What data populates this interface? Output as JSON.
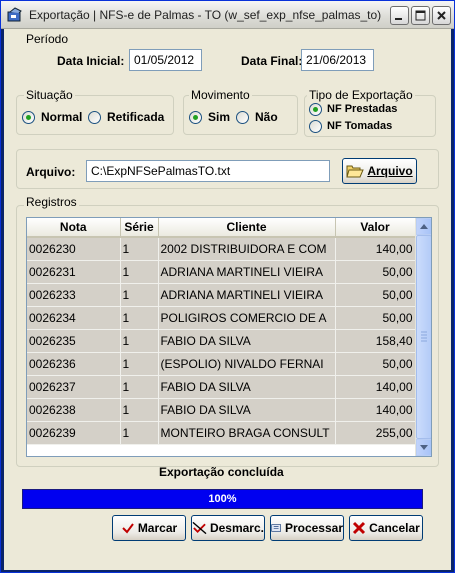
{
  "window": {
    "title": "Exportação | NFS-e de Palmas - TO (w_sef_exp_nfse_palmas_to)"
  },
  "periodo": {
    "group_title": "Período",
    "data_inicial_label": "Data Inicial:",
    "data_inicial_value": "01/05/2012",
    "data_final_label": "Data Final:",
    "data_final_value": "21/06/2013"
  },
  "situacao": {
    "group_title": "Situação",
    "options": [
      "Normal",
      "Retificada"
    ],
    "selected": "Normal"
  },
  "movimento": {
    "group_title": "Movimento",
    "options": [
      "Sim",
      "Não"
    ],
    "selected": "Sim"
  },
  "tipo_exportacao": {
    "group_title": "Tipo de Exportação",
    "options": [
      "NF Prestadas",
      "NF Tomadas"
    ],
    "selected": "NF Prestadas"
  },
  "arquivo": {
    "label": "Arquivo:",
    "value": "C:\\ExpNFSePalmasTO.txt",
    "button_label": "Arquivo"
  },
  "registros": {
    "group_title": "Registros",
    "columns": [
      "Nota",
      "Série",
      "Cliente",
      "Valor"
    ],
    "rows": [
      [
        "0026230",
        "1",
        "2002 DISTRIBUIDORA E COM",
        "140,00"
      ],
      [
        "0026231",
        "1",
        "ADRIANA MARTINELI VIEIRA",
        "50,00"
      ],
      [
        "0026233",
        "1",
        "ADRIANA MARTINELI VIEIRA",
        "50,00"
      ],
      [
        "0026234",
        "1",
        "POLIGIROS COMERCIO DE A",
        "50,00"
      ],
      [
        "0026235",
        "1",
        "FABIO DA SILVA",
        "158,40"
      ],
      [
        "0026236",
        "1",
        "(ESPOLIO) NIVALDO FERNAI",
        "50,00"
      ],
      [
        "0026237",
        "1",
        "FABIO DA SILVA",
        "140,00"
      ],
      [
        "0026238",
        "1",
        "FABIO DA SILVA",
        "140,00"
      ],
      [
        "0026239",
        "1",
        "MONTEIRO BRAGA CONSULT",
        "255,00"
      ]
    ]
  },
  "status": {
    "text": "Exportação concluída",
    "progress_text": "100%",
    "progress_value": 1.0
  },
  "buttons": {
    "marcar": "Marcar",
    "desmarcar": "Desmarc.",
    "processar": "Processar",
    "cancelar": "Cancelar"
  },
  "colors": {
    "progress": "#0000ff",
    "radio_dot": "#21a121",
    "row_bg": "#d4d0c8"
  },
  "icons": {
    "app": "app-icon",
    "folder": "folder-open-icon",
    "marcar": "checkmark-icon",
    "desmarcar": "uncheck-icon",
    "processar": "gear-process-icon",
    "cancelar": "x-cancel-icon"
  }
}
